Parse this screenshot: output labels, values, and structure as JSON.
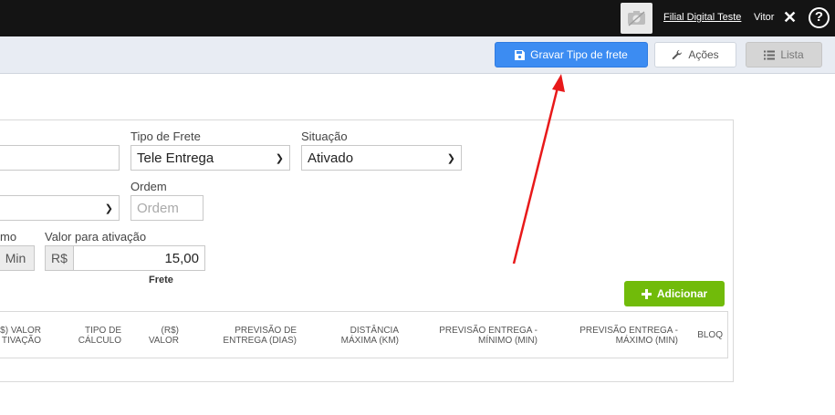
{
  "topbar": {
    "branch_link": "Filial Digital Teste",
    "user_name": "Vitor",
    "close_icon": "close-icon",
    "help_icon": "help-circle-icon",
    "help_glyph": "?"
  },
  "toolbar": {
    "save_label": "Gravar Tipo de frete",
    "actions_label": "Ações",
    "list_label": "Lista"
  },
  "form": {
    "tipo_frete_label": "Tipo de Frete",
    "tipo_frete_value": "Tele Entrega",
    "situacao_label": "Situação",
    "situacao_value": "Ativado",
    "ordem_label": "Ordem",
    "ordem_placeholder": "Ordem",
    "partial_label": "mo",
    "min_addon": "Min",
    "valor_ativacao_label": "Valor para ativação",
    "currency_addon": "R$",
    "valor_ativacao_value": "15,00",
    "frete_label": "Frete"
  },
  "add_button": {
    "label": "Adicionar"
  },
  "table": {
    "columns": [
      "$) VALOR\nTIVAÇÃO",
      "TIPO DE\nCÁLCULO",
      "(R$)\nVALOR",
      "PREVISÃO DE\nENTREGA (DIAS)",
      "DISTÂNCIA\nMÁXIMA (KM)",
      "PREVISÃO ENTREGA -\nMÍNIMO (MIN)",
      "PREVISÃO ENTREGA -\nMÁXIMO (MIN)",
      "BLOQ"
    ]
  },
  "colors": {
    "topbar": "#141414",
    "primary": "#3c8cf2",
    "success": "#71bb0a",
    "annotation_arrow": "#e8191a"
  }
}
